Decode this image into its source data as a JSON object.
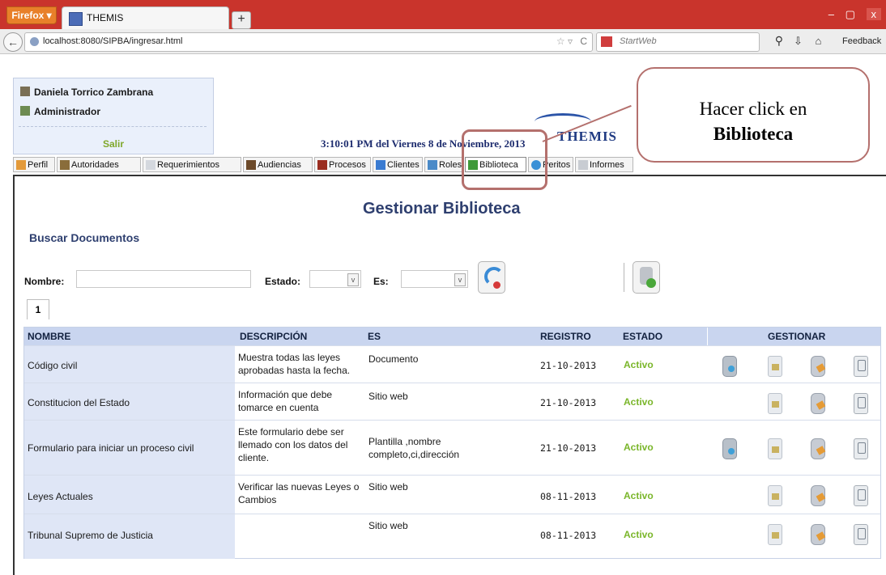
{
  "browser": {
    "firefox_label": "Firefox",
    "tab_title": "THEMIS",
    "new_tab": "+",
    "url": "localhost:8080/SIPBA/ingresar.html",
    "search_engine": "StartWeb",
    "feedback": "Feedback"
  },
  "user": {
    "name": "Daniela Torrico Zambrana",
    "role": "Administrador",
    "logout": "Salir"
  },
  "header": {
    "datetime": "3:10:01 PM del Viernes 8 de Noviembre, 2013",
    "logo_text": "THEMIS"
  },
  "menu": {
    "items": [
      {
        "label": "Perfil"
      },
      {
        "label": "Autoridades"
      },
      {
        "label": "Requerimientos"
      },
      {
        "label": "Audiencias"
      },
      {
        "label": "Procesos"
      },
      {
        "label": "Clientes"
      },
      {
        "label": "Roles"
      },
      {
        "label": "Biblioteca"
      },
      {
        "label": "Peritos"
      },
      {
        "label": "Informes"
      }
    ],
    "active": "Biblioteca"
  },
  "page": {
    "title": "Gestionar Biblioteca",
    "section": "Buscar Documentos"
  },
  "search": {
    "nombre_label": "Nombre:",
    "nombre_value": "",
    "estado_label": "Estado:",
    "estado_value": "",
    "es_label": "Es:",
    "es_value": ""
  },
  "pagination": {
    "current_page": "1"
  },
  "table": {
    "headers": {
      "nombre": "NOMBRE",
      "descripcion": "DESCRIPCIÓN",
      "es": "ES",
      "registro": "REGISTRO",
      "estado": "ESTADO",
      "gestionar": "GESTIONAR"
    },
    "rows": [
      {
        "nombre": "Código civil",
        "descripcion": "Muestra todas las leyes aprobadas hasta la fecha.",
        "es": "Documento",
        "registro": "21-10-2013",
        "estado": "Activo",
        "has_file": true
      },
      {
        "nombre": "Constitucion del Estado",
        "descripcion": "Información que debe tomarce en cuenta",
        "es": "Sitio web",
        "registro": "21-10-2013",
        "estado": "Activo",
        "has_file": false
      },
      {
        "nombre": "Formulario para iniciar un proceso civil",
        "descripcion": "Este formulario debe ser llemado con los datos del cliente.",
        "es": "Plantilla ,nombre completo,ci,dirección",
        "registro": "21-10-2013",
        "estado": "Activo",
        "has_file": true
      },
      {
        "nombre": "Leyes Actuales",
        "descripcion": "Verificar las nuevas Leyes o Cambios",
        "es": "Sitio web",
        "registro": "08-11-2013",
        "estado": "Activo",
        "has_file": false
      },
      {
        "nombre": "Tribunal Supremo de Justicia",
        "descripcion": "",
        "es": "Sitio web",
        "registro": "08-11-2013",
        "estado": "Activo",
        "has_file": false
      }
    ]
  },
  "callout": {
    "line1": "Hacer click en",
    "line2": "Biblioteca"
  },
  "colors": {
    "estado_activo": "#7ab62a",
    "header_bg": "#c9d5ef",
    "title": "#2e3f6f",
    "callout_border": "#b4706d"
  }
}
